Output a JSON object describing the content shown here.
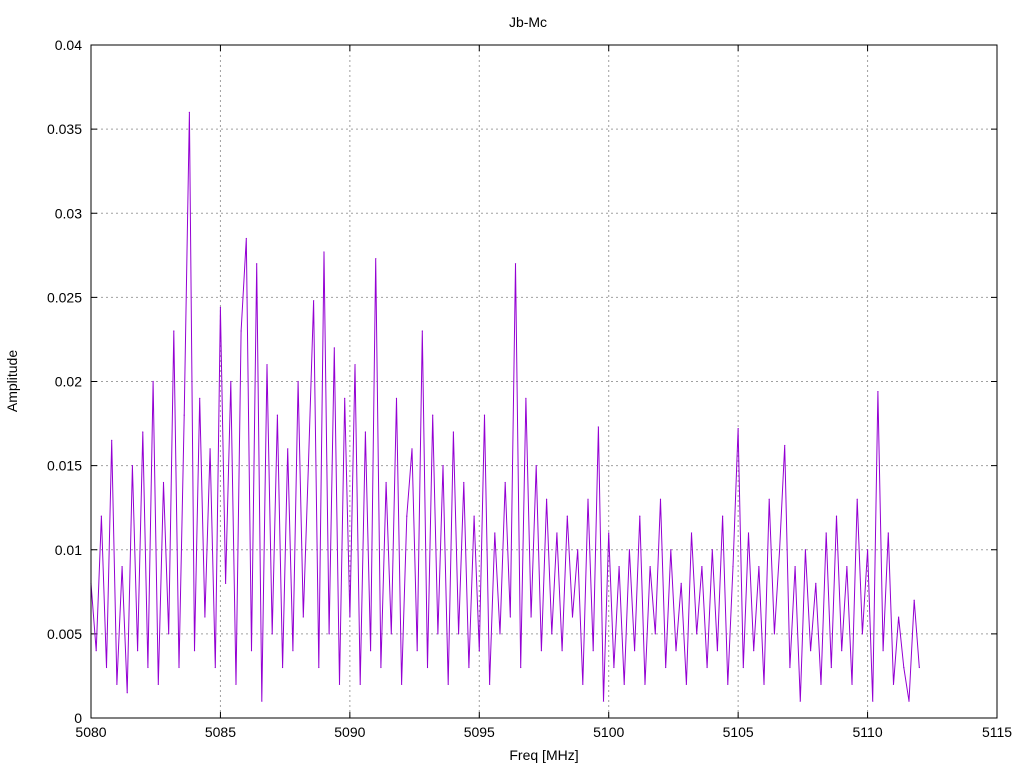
{
  "chart_data": {
    "type": "line",
    "title": "Jb-Mc",
    "xlabel": "Freq [MHz]",
    "ylabel": "Amplitude",
    "xlim": [
      5080,
      5115
    ],
    "ylim": [
      0,
      0.04
    ],
    "xticks": [
      "5080",
      "5085",
      "5090",
      "5095",
      "5100",
      "5105",
      "5110",
      "5115"
    ],
    "yticks": [
      "0",
      "0.005",
      "0.01",
      "0.015",
      "0.02",
      "0.025",
      "0.03",
      "0.035",
      "0.04"
    ],
    "grid": true,
    "series": [
      {
        "name": "Jb-Mc",
        "color": "#9400d3",
        "x_start": 5080,
        "x_step": 0.2,
        "values": [
          0.008,
          0.004,
          0.012,
          0.003,
          0.0165,
          0.002,
          0.009,
          0.0015,
          0.015,
          0.004,
          0.017,
          0.003,
          0.02,
          0.002,
          0.014,
          0.005,
          0.023,
          0.003,
          0.018,
          0.036,
          0.004,
          0.019,
          0.006,
          0.016,
          0.003,
          0.0244,
          0.008,
          0.02,
          0.002,
          0.023,
          0.0285,
          0.004,
          0.027,
          0.001,
          0.021,
          0.005,
          0.018,
          0.003,
          0.016,
          0.004,
          0.02,
          0.006,
          0.015,
          0.0248,
          0.003,
          0.0277,
          0.005,
          0.022,
          0.002,
          0.019,
          0.006,
          0.021,
          0.002,
          0.017,
          0.004,
          0.0273,
          0.003,
          0.014,
          0.005,
          0.019,
          0.002,
          0.012,
          0.016,
          0.004,
          0.023,
          0.003,
          0.018,
          0.005,
          0.015,
          0.002,
          0.017,
          0.005,
          0.014,
          0.003,
          0.012,
          0.004,
          0.018,
          0.002,
          0.011,
          0.005,
          0.014,
          0.006,
          0.027,
          0.003,
          0.019,
          0.006,
          0.015,
          0.004,
          0.013,
          0.005,
          0.011,
          0.004,
          0.012,
          0.006,
          0.01,
          0.002,
          0.013,
          0.004,
          0.0173,
          0.001,
          0.011,
          0.003,
          0.009,
          0.002,
          0.01,
          0.004,
          0.012,
          0.002,
          0.009,
          0.005,
          0.013,
          0.003,
          0.01,
          0.004,
          0.008,
          0.002,
          0.011,
          0.005,
          0.009,
          0.003,
          0.01,
          0.004,
          0.012,
          0.002,
          0.009,
          0.0172,
          0.003,
          0.011,
          0.004,
          0.009,
          0.002,
          0.013,
          0.005,
          0.01,
          0.0162,
          0.003,
          0.009,
          0.001,
          0.01,
          0.004,
          0.008,
          0.002,
          0.011,
          0.003,
          0.012,
          0.004,
          0.009,
          0.002,
          0.013,
          0.005,
          0.01,
          0.001,
          0.0194,
          0.004,
          0.011,
          0.002,
          0.006,
          0.003,
          0.001,
          0.007,
          0.003
        ]
      }
    ]
  }
}
